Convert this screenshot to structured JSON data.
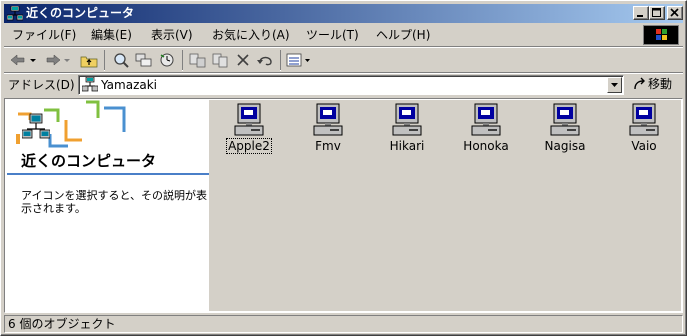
{
  "window": {
    "title": "近くのコンピュータ",
    "controls": [
      "minimize",
      "maximize",
      "close"
    ]
  },
  "menu": [
    {
      "label": "ファイル(F)"
    },
    {
      "label": "編集(E)"
    },
    {
      "label": "表示(V)"
    },
    {
      "label": "お気に入り(A)"
    },
    {
      "label": "ツール(T)"
    },
    {
      "label": "ヘルプ(H)"
    }
  ],
  "toolbar": {
    "buttons": [
      "back-icon",
      "forward-icon",
      "up-folder-icon",
      "search-icon",
      "folders-icon",
      "history-icon",
      "move-to-icon",
      "copy-to-icon",
      "delete-icon",
      "undo-icon",
      "views-icon"
    ]
  },
  "address": {
    "label": "アドレス(D)",
    "value": "Yamazaki",
    "go_label": "移動"
  },
  "left_pane": {
    "title": "近くのコンピュータ",
    "description": "アイコンを選択すると、その説明が表示されます。"
  },
  "computers": [
    {
      "name": "Apple2"
    },
    {
      "name": "Fmv"
    },
    {
      "name": "Hikari"
    },
    {
      "name": "Honoka"
    },
    {
      "name": "Nagisa"
    },
    {
      "name": "Vaio"
    }
  ],
  "status": {
    "text": "6 個のオブジェクト"
  },
  "colors": {
    "title_bar_start": "#0a246a",
    "title_bar_end": "#a6caf0",
    "face": "#d4d0c8",
    "accent_line": "#4a7fc8"
  }
}
